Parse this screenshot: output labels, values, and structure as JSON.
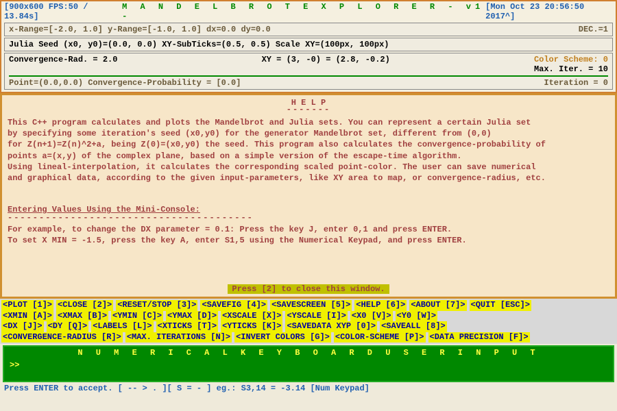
{
  "header": {
    "left": "[900x600 FPS:50 / 13.84s]",
    "center": "M A N D E L B R O T   E X P L O R E R   - v1 -",
    "right": "[Mon Oct 23 20:56:50 2017^]"
  },
  "status": {
    "line1_left": "x-Range=[-2.0, 1.0] y-Range=[-1.0, 1.0] dx=0.0 dy=0.0",
    "line1_right": "DEC.=1",
    "line2": "Julia Seed (x0, y0)=(0.0, 0.0) XY-SubTicks=(0.5, 0.5) Scale XY=(100px, 100px)",
    "line3_left": "Convergence-Rad. = 2.0",
    "line3_mid": "XY = (3, -0) = (2.8, -0.2)",
    "line3_color": "Color Scheme: 0",
    "line3_iter": "Max. Iter. = 10",
    "line4_left": "Point=(0.0,0.0)  Convergence-Probability = [0.0]",
    "line4_right": "Iteration = 0"
  },
  "help": {
    "title": "H E L P",
    "title_uline": "-------",
    "p1": "This C++ program calculates and plots the Mandelbrot and Julia sets. You can represent a certain Julia set",
    "p2": "by specifying some iteration's seed (x0,y0) for the generator Mandelbrot set, different from (0,0)",
    "p3": "for Z(n+1)=Z(n)^2+a, being Z(0)=(x0,y0) the seed. This program also calculates the convergence-probability of",
    "p4": "points a=(x,y) of the complex plane, based on a simple version of the escape-time algorithm.",
    "p5": "Using lineal-interpolation, it calculates the corresponding scaled point-color. The user can save numerical",
    "p6": "and graphical data, according to the given input-parameters, like XY area to map, or convergence-radius, etc.",
    "sub": "Entering Values Using the Mini-Console:",
    "sub_dash": "---------------------------------------",
    "ex1": "For example, to change the DX parameter = 0.1: Press the key J, enter 0,1 and press ENTER.",
    "ex2": "To set X MIN = -1.5, press the key A, enter S1,5 using the Numerical Keypad, and press ENTER.",
    "close": "Press [2] to close this window."
  },
  "commands": {
    "row1": [
      "<PLOT [1]>",
      "<CLOSE [2]>",
      "<RESET/STOP [3]>",
      "<SAVEFIG [4]>",
      "<SAVESCREEN [5]>",
      "<HELP [6]>",
      "<ABOUT [7]>",
      "<QUIT [ESC]>"
    ],
    "row2": [
      "<XMIN [A]>",
      "<XMAX [B]>",
      "<YMIN [C]>",
      "<YMAX [D]>",
      "<XSCALE [X]>",
      "<YSCALE [I]>",
      "<X0 [V]>",
      "<Y0 [W]>"
    ],
    "row3": [
      "<DX [J]>",
      "<DY [Q]>",
      "<LABELS [L]>",
      "<XTICKS [T]>",
      "<YTICKS [K]>",
      "<SAVEDATA XYP [0]>",
      "<SAVEALL [8]>"
    ],
    "row4": [
      "<CONVERGENCE-RADIUS [R]>",
      "<MAX. ITERATIONS [N]>",
      "<INVERT COLORS [G]>",
      "<COLOR-SCHEME [P]>",
      "<DATA PRECISION [F]>"
    ]
  },
  "numpad": {
    "title": "N U M E R I C A L   K E Y B O A R D   U S E R   I N P U T",
    "prompt": ">>"
  },
  "footer": "Press ENTER to accept.     [ -- > . ][ S = - ] eg.: S3,14 = -3.14 [Num Keypad]"
}
